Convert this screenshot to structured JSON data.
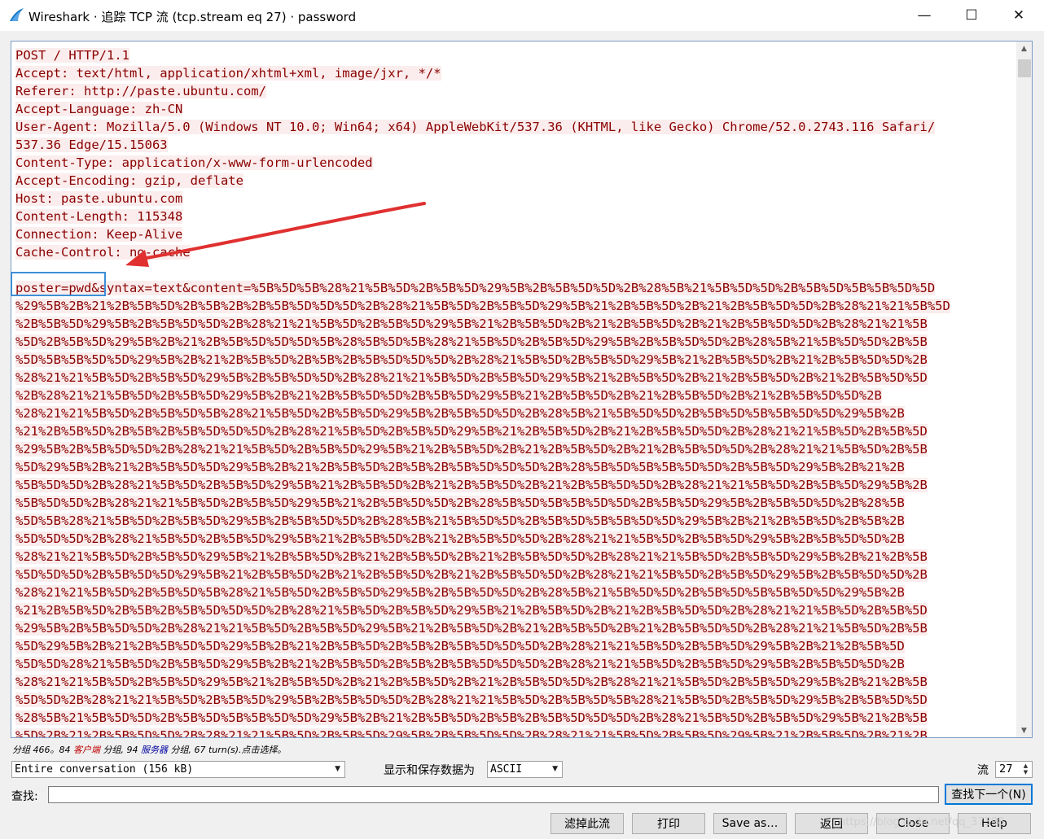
{
  "window": {
    "title": "Wireshark · 追踪 TCP 流 (tcp.stream eq 27) · password",
    "minimize_glyph": "—",
    "maximize_glyph": "☐",
    "close_glyph": "✕"
  },
  "stream": {
    "lines": [
      "POST / HTTP/1.1",
      "Accept: text/html, application/xhtml+xml, image/jxr, */*",
      "Referer: http://paste.ubuntu.com/",
      "Accept-Language: zh-CN",
      "User-Agent: Mozilla/5.0 (Windows NT 10.0; Win64; x64) AppleWebKit/537.36 (KHTML, like Gecko) Chrome/52.0.2743.116 Safari/",
      "537.36 Edge/15.15063",
      "Content-Type: application/x-www-form-urlencoded",
      "Accept-Encoding: gzip, deflate",
      "Host: paste.ubuntu.com",
      "Content-Length: 115348",
      "Connection: Keep-Alive",
      "Cache-Control: no-cache",
      "",
      "poster=pwd&syntax=text&content=%5B%5D%5B%28%21%5B%5D%2B%5B%5D%29%5B%2B%5B%5D%5D%2B%28%5B%21%5B%5D%5D%2B%5B%5D%5B%5B%5D%5D",
      "%29%5B%2B%21%2B%5B%5D%2B%5B%2B%2B%5B%5D%5D%5D%2B%28%21%5B%5D%2B%5B%5D%29%5B%21%2B%5B%5D%2B%21%2B%5B%5D%5D%2B%28%21%21%5B%5D",
      "%2B%5B%5D%29%5B%2B%5B%5D%5D%2B%28%21%21%5B%5D%2B%5B%5D%29%5B%21%2B%5B%5D%2B%21%2B%5B%5D%2B%21%2B%5B%5D%5D%2B%28%21%21%5B",
      "%5D%2B%5B%5D%29%5B%2B%21%2B%5B%5D%5D%5D%5B%28%5B%5D%5B%28%21%5B%5D%2B%5B%5D%29%5B%2B%5B%5D%5D%2B%28%5B%21%5B%5D%5D%2B%5B",
      "%5D%5B%5B%5D%5D%29%5B%2B%21%2B%5B%5D%2B%5B%2B%5B%5D%5D%5D%2B%28%21%5B%5D%2B%5B%5D%29%5B%21%2B%5B%5D%2B%21%2B%5B%5D%5D%2B",
      "%28%21%21%5B%5D%2B%5B%5D%29%5B%2B%5B%5D%5D%2B%28%21%21%5B%5D%2B%5B%5D%29%5B%21%2B%5B%5D%2B%21%2B%5B%5D%2B%21%2B%5B%5D%5D",
      "%2B%28%21%21%5B%5D%2B%5B%5D%29%5B%2B%21%2B%5B%5D%5D%2B%5B%5D%29%5B%21%2B%5B%5D%2B%21%2B%5B%5D%2B%21%2B%5B%5D%5D%2B",
      "%28%21%21%5B%5D%2B%5B%5D%5B%28%21%5B%5D%2B%5B%5D%29%5B%2B%5B%5D%5D%2B%28%5B%21%5B%5D%5D%2B%5B%5D%5B%5B%5D%5D%29%5B%2B",
      "%21%2B%5B%5D%2B%5B%2B%5B%5D%5D%5D%2B%28%21%5B%5D%2B%5B%5D%29%5B%21%2B%5B%5D%2B%21%2B%5B%5D%5D%2B%28%21%21%5B%5D%2B%5B%5D",
      "%29%5B%2B%5B%5D%5D%2B%28%21%21%5B%5D%2B%5B%5D%29%5B%21%2B%5B%5D%2B%21%2B%5B%5D%2B%21%2B%5B%5D%5D%2B%28%21%21%5B%5D%2B%5B",
      "%5D%29%5B%2B%21%2B%5B%5D%5D%29%5B%2B%21%2B%5B%5D%2B%5B%2B%5B%5D%5D%5D%2B%28%5B%5D%5B%5B%5D%5D%2B%5B%5D%29%5B%2B%21%2B",
      "%5B%5D%5D%2B%28%21%5B%5D%2B%5B%5D%29%5B%21%2B%5B%5D%2B%21%2B%5B%5D%2B%21%2B%5B%5D%5D%2B%28%21%21%5B%5D%2B%5B%5D%29%5B%2B",
      "%5B%5D%5D%2B%28%21%21%5B%5D%2B%5B%5D%29%5B%21%2B%5B%5D%5D%2B%28%5B%5D%5B%5B%5D%5D%2B%5B%5D%29%5B%2B%5B%5D%5D%2B%28%5B",
      "%5D%5B%28%21%5B%5D%2B%5B%5D%29%5B%2B%5B%5D%5D%2B%28%5B%21%5B%5D%5D%2B%5B%5D%5B%5B%5D%5D%29%5B%2B%21%2B%5B%5D%2B%5B%2B",
      "%5D%5D%5D%2B%28%21%5B%5D%2B%5B%5D%29%5B%21%2B%5B%5D%2B%21%2B%5B%5D%5D%2B%28%21%21%5B%5D%2B%5B%5D%29%5B%2B%5B%5D%5D%2B",
      "%28%21%21%5B%5D%2B%5B%5D%29%5B%21%2B%5B%5D%2B%21%2B%5B%5D%2B%21%2B%5B%5D%5D%2B%28%21%21%5B%5D%2B%5B%5D%29%5B%2B%21%2B%5B",
      "%5D%5D%5D%2B%5B%5D%5D%29%5B%21%2B%5B%5D%2B%21%2B%5B%5D%2B%21%2B%5B%5D%5D%2B%28%21%21%5B%5D%2B%5B%5D%29%5B%2B%5B%5D%5D%2B",
      "%28%21%21%5B%5D%2B%5B%5D%5B%28%21%5B%5D%2B%5B%5D%29%5B%2B%5B%5D%5D%2B%28%5B%21%5B%5D%5D%2B%5B%5D%5B%5B%5D%5D%29%5B%2B",
      "%21%2B%5B%5D%2B%5B%2B%5B%5D%5D%5D%2B%28%21%5B%5D%2B%5B%5D%29%5B%21%2B%5B%5D%2B%21%2B%5B%5D%5D%2B%28%21%21%5B%5D%2B%5B%5D",
      "%29%5B%2B%5B%5D%5D%2B%28%21%21%5B%5D%2B%5B%5D%29%5B%21%2B%5B%5D%2B%21%2B%5B%5D%2B%21%2B%5B%5D%5D%2B%28%21%21%5B%5D%2B%5B",
      "%5D%29%5B%2B%21%2B%5B%5D%5D%29%5B%2B%21%2B%5B%5D%2B%5B%2B%5B%5D%5D%5D%2B%28%21%21%5B%5D%2B%5B%5D%29%5B%2B%21%2B%5B%5D",
      "%5D%5D%28%21%5B%5D%2B%5B%5D%29%5B%2B%21%2B%5B%5D%2B%5B%2B%5B%5D%5D%5D%2B%28%21%21%5B%5D%2B%5B%5D%29%5B%2B%5B%5D%5D%2B",
      "%28%21%21%5B%5D%2B%5B%5D%29%5B%21%2B%5B%5D%2B%21%2B%5B%5D%2B%21%2B%5B%5D%5D%2B%28%21%21%5B%5D%2B%5B%5D%29%5B%2B%21%2B%5B",
      "%5D%5D%2B%28%21%21%5B%5D%2B%5B%5D%29%5B%2B%5B%5D%5D%2B%28%21%21%5B%5D%2B%5B%5D%5B%28%21%5B%5D%2B%5B%5D%29%5B%2B%5B%5D%5D",
      "%28%5B%21%5B%5D%5D%2B%5B%5D%5B%5B%5D%5D%29%5B%2B%21%2B%5B%5D%2B%5B%2B%5B%5D%5D%5D%2B%28%21%5B%5D%2B%5B%5D%29%5B%21%2B%5B",
      "%5D%2B%21%2B%5B%5D%5D%2B%28%21%21%5B%5D%2B%5B%5D%29%5B%2B%5B%5D%5D%2B%28%21%21%5B%5D%2B%5B%5D%29%5B%21%2B%5B%5D%2B%21%2B"
    ]
  },
  "status": {
    "prefix": "分组 466。84 ",
    "client": "客户端",
    "middle": " 分组, 94 ",
    "server": "服务器",
    "suffix": " 分组, 67 turn(s).点击选择。"
  },
  "controls": {
    "conversation_select": "Entire conversation (156 kB)",
    "show_save_label": "显示和保存数据为",
    "format_select": "ASCII",
    "stream_label": "流",
    "stream_value": "27",
    "find_label": "查找:",
    "find_value": "",
    "find_next": "查找下一个(N)"
  },
  "buttons": {
    "filter_out": "滤掉此流",
    "print": "打印",
    "save_as": "Save as…",
    "back": "返回",
    "close": "Close",
    "help": "Help"
  },
  "watermark": "https://blog.csdn.net/qq_37398",
  "colors": {
    "client_text": "#8b0000",
    "client_bg": "#fbeded",
    "highlight_box": "#3d8fd6",
    "arrow": "#e03030"
  }
}
